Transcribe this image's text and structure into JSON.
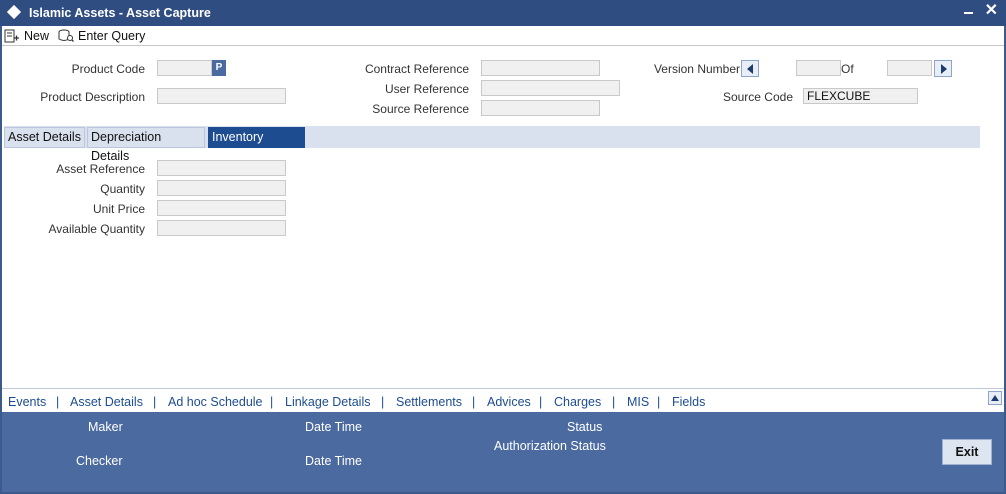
{
  "window": {
    "title": "Islamic Assets - Asset Capture"
  },
  "toolbar": {
    "new_label": "New",
    "enter_query_label": "Enter Query"
  },
  "header": {
    "product_code_label": "Product Code",
    "product_code_value": "",
    "product_code_button": "P",
    "product_description_label": "Product Description",
    "product_description_value": "",
    "contract_reference_label": "Contract Reference",
    "contract_reference_value": "",
    "user_reference_label": "User Reference",
    "user_reference_value": "",
    "source_reference_label": "Source Reference",
    "source_reference_value": "",
    "version_number_label": "Version Number",
    "version_number_value": "",
    "of_label": "Of",
    "version_total_value": "",
    "source_code_label": "Source Code",
    "source_code_value": "FLEXCUBE"
  },
  "tabs": [
    {
      "label": "Asset Details"
    },
    {
      "label": "Depreciation Details"
    },
    {
      "label": "Inventory Details"
    }
  ],
  "active_tab": "Inventory Details",
  "inventory": {
    "asset_reference_label": "Asset Reference",
    "asset_reference_value": "",
    "quantity_label": "Quantity",
    "quantity_value": "",
    "unit_price_label": "Unit Price",
    "unit_price_value": "",
    "available_quantity_label": "Available Quantity",
    "available_quantity_value": ""
  },
  "bottom_links": [
    "Events",
    "Asset Details",
    "Ad hoc Schedule",
    "Linkage Details",
    "Settlements",
    "Advices",
    "Charges",
    "MIS",
    "Fields"
  ],
  "footer": {
    "maker_label": "Maker",
    "checker_label": "Checker",
    "date_time_label": "Date Time",
    "status_label": "Status",
    "authorization_status_label": "Authorization Status",
    "exit_label": "Exit"
  },
  "colors": {
    "title_bar": "#2f4d80",
    "active_tab": "#1d4c91",
    "footer": "#4b6aa0"
  }
}
